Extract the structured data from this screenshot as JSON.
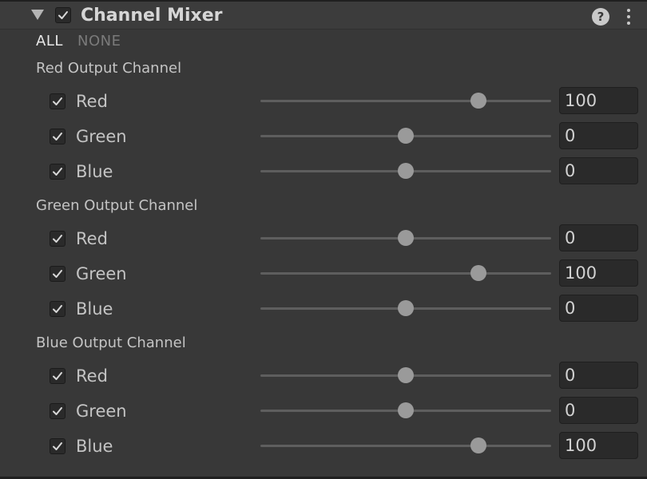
{
  "header": {
    "title": "Channel Mixer",
    "enabled": true,
    "help_glyph": "?",
    "icons": [
      "foldout-triangle-icon",
      "help-icon",
      "more-menu-icon"
    ]
  },
  "toggles": {
    "all_label": "ALL",
    "none_label": "NONE"
  },
  "value_range": [
    -200,
    200
  ],
  "sections": [
    {
      "label": "Red Output Channel",
      "rows": [
        {
          "label": "Red",
          "checked": true,
          "value": "100"
        },
        {
          "label": "Green",
          "checked": true,
          "value": "0"
        },
        {
          "label": "Blue",
          "checked": true,
          "value": "0"
        }
      ]
    },
    {
      "label": "Green Output Channel",
      "rows": [
        {
          "label": "Red",
          "checked": true,
          "value": "0"
        },
        {
          "label": "Green",
          "checked": true,
          "value": "100"
        },
        {
          "label": "Blue",
          "checked": true,
          "value": "0"
        }
      ]
    },
    {
      "label": "Blue Output Channel",
      "rows": [
        {
          "label": "Red",
          "checked": true,
          "value": "0"
        },
        {
          "label": "Green",
          "checked": true,
          "value": "0"
        },
        {
          "label": "Blue",
          "checked": true,
          "value": "100"
        }
      ]
    }
  ],
  "colors": {
    "panel_bg": "#383838",
    "header_bg": "#3c3c3c",
    "text": "#c4c4c4",
    "muted_text": "#7a7a7a",
    "field_bg": "#2a2a2a",
    "thumb": "#9a9a9a",
    "track": "#5e5e5e"
  }
}
